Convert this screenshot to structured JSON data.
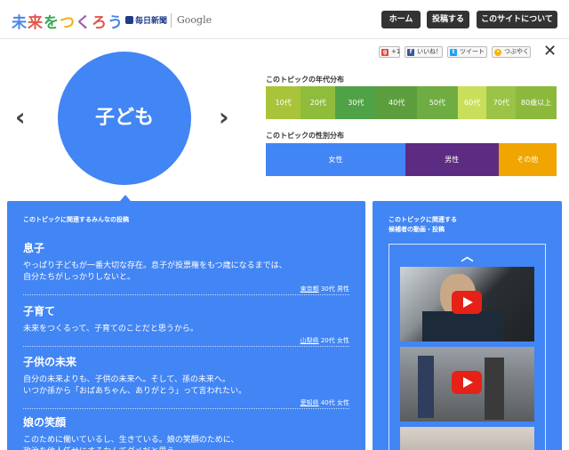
{
  "header": {
    "logo_chars": [
      "未",
      "来",
      "を",
      "つ",
      "く",
      "ろ",
      "う"
    ],
    "mainichi": "毎日新聞",
    "google": "Google",
    "nav": [
      "ホーム",
      "投稿する",
      "このサイトについて"
    ]
  },
  "social": {
    "gplus": "+1",
    "facebook": "いいね！",
    "twitter": "ツイート",
    "tsubuyaku": "つぶやく",
    "close_icon": "close-icon"
  },
  "topic": {
    "label": "子ども",
    "color": "#4285f4"
  },
  "age_distribution": {
    "title": "このトピックの年代分布",
    "segments": [
      {
        "label": "10代",
        "color": "#a9c43a",
        "share": 12
      },
      {
        "label": "20代",
        "color": "#8fbc3b",
        "share": 12
      },
      {
        "label": "30代",
        "color": "#4fa245",
        "share": 14
      },
      {
        "label": "40代",
        "color": "#5c9e3e",
        "share": 14
      },
      {
        "label": "50代",
        "color": "#6fac42",
        "share": 14
      },
      {
        "label": "60代",
        "color": "#c9df5b",
        "share": 10
      },
      {
        "label": "70代",
        "color": "#9bc447",
        "share": 10
      },
      {
        "label": "80歳以上",
        "color": "#8cb83c",
        "share": 14
      }
    ]
  },
  "gender_distribution": {
    "title": "このトピックの性別分布",
    "segments": [
      {
        "label": "女性",
        "color": "#4285f4",
        "share": 48
      },
      {
        "label": "男性",
        "color": "#5c2b82",
        "share": 32
      },
      {
        "label": "その他",
        "color": "#f0a500",
        "share": 20
      }
    ]
  },
  "posts_panel": {
    "title": "このトピックに関連するみんなの投稿",
    "posts": [
      {
        "title": "息子",
        "body": "やっぱり子どもが一番大切な存在。息子が投票権をもつ歳になるまでは、\n自分たちがしっかりしないと。",
        "pref": "東京都",
        "age": "30代",
        "gender": "男性"
      },
      {
        "title": "子育て",
        "body": "未来をつくるって、子育てのことだと思うから。",
        "pref": "山梨県",
        "age": "20代",
        "gender": "女性"
      },
      {
        "title": "子供の未来",
        "body": "自分の未来よりも、子供の未来へ。そして、孫の未来へ。\nいつか孫から「おばあちゃん、ありがとう」って言われたい。",
        "pref": "愛知県",
        "age": "40代",
        "gender": "女性"
      },
      {
        "title": "娘の笑顔",
        "body": "このために働いているし、生きている。娘の笑顔のために、\n政治を他人任せにするなんてダメだと思う。",
        "pref": "",
        "age": "",
        "gender": ""
      }
    ]
  },
  "side_panel": {
    "title": "このトピックに関連する\n候補者の動画・投稿"
  }
}
